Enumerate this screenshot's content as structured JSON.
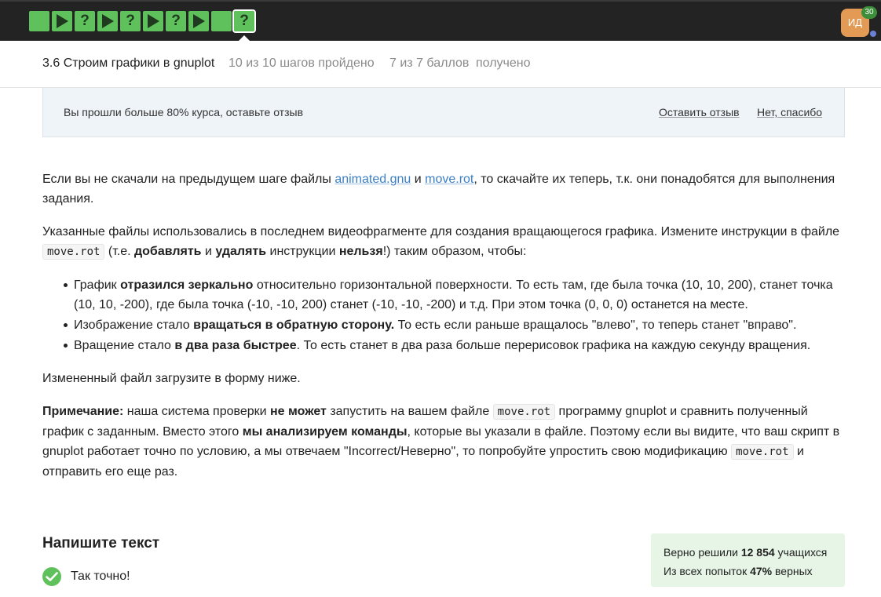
{
  "topbar": {
    "steps": [
      {
        "type": "done",
        "icon": "square"
      },
      {
        "type": "video",
        "icon": "play"
      },
      {
        "type": "quiz",
        "icon": "?"
      },
      {
        "type": "video",
        "icon": "play"
      },
      {
        "type": "quiz",
        "icon": "?"
      },
      {
        "type": "video",
        "icon": "play"
      },
      {
        "type": "quiz",
        "icon": "?"
      },
      {
        "type": "video",
        "icon": "play"
      },
      {
        "type": "done",
        "icon": "square"
      },
      {
        "type": "quiz",
        "icon": "?",
        "active": true
      }
    ],
    "avatar_initials": "ИД",
    "notification_count": "30"
  },
  "lesson": {
    "title": "3.6 Строим графики в gnuplot",
    "progress": "10 из 10 шагов пройдено",
    "score": "7 из 7 баллов",
    "score_suffix": "получено"
  },
  "banner": {
    "text": "Вы прошли больше 80% курса, оставьте отзыв",
    "leave_review": "Оставить отзыв",
    "no_thanks": "Нет, спасибо"
  },
  "content": {
    "p1_a": "Если вы не скачали на предыдущем шаге файлы ",
    "link1": "animated.gnu",
    "p1_b": " и ",
    "link2": "move.rot",
    "p1_c": ", то скачайте их теперь, т.к. они понадобятся для выполнения задания.",
    "p2_a": "Указанные файлы использовались в последнем видеофрагменте для создания вращающегося графика. Измените инструкции в файле ",
    "code_file": "move.rot",
    "p2_b": " (т.е. ",
    "p2_add": "добавлять",
    "p2_c": " и ",
    "p2_del": "удалять",
    "p2_d": " инструкции ",
    "p2_forbid": "нельзя",
    "p2_e": "!) таким образом, чтобы:",
    "li1_a": "График ",
    "li1_b": "отразился зеркально",
    "li1_c": " относительно горизонтальной поверхности. То есть там, где была точка (10, 10, 200), станет точка (10, 10, -200), где была точка  (-10, -10, 200) станет (-10, -10, -200) и т.д. При этом точка (0, 0, 0) останется на месте.",
    "li2_a": "Изображение стало ",
    "li2_b": "вращаться в обратную сторону.",
    "li2_c": " То есть если раньше вращалось \"влево\", то теперь станет \"вправо\".",
    "li3_a": "Вращение стало ",
    "li3_b": "в два раза быстрее",
    "li3_c": ". То есть станет в два раза больше перерисовок графика на каждую секунду вращения.",
    "p3": "Измененный файл загрузите в форму ниже.",
    "note_label": "Примечание:",
    "note_a": " наша система проверки ",
    "note_b": "не может",
    "note_c": " запустить на вашем файле ",
    "note_d": " программу gnuplot и сравнить полученный график с заданным. Вместо этого ",
    "note_e": "мы анализируем команды",
    "note_f": ", которые вы указали в файле. Поэтому если вы видите, что ваш скрипт в gnuplot работает точно по условию, а мы отвечаем \"Incorrect/Неверно\", то попробуйте упростить свою модификацию ",
    "note_g": " и отправить его еще раз."
  },
  "answer": {
    "title": "Напишите текст",
    "result_text": "Так точно!"
  },
  "stats": {
    "line1_a": "Верно решили ",
    "solved_count": "12 854",
    "line1_b": " учащихся",
    "line2_a": "Из всех попыток ",
    "percent": "47%",
    "line2_b": " верных"
  },
  "colors": {
    "topbar": "#232323",
    "step_green": "#5fc15b",
    "link": "#3b7fc4",
    "banner_bg": "#eef4f8",
    "stats_bg": "#e6f5e5",
    "avatar": "#e39a55"
  }
}
